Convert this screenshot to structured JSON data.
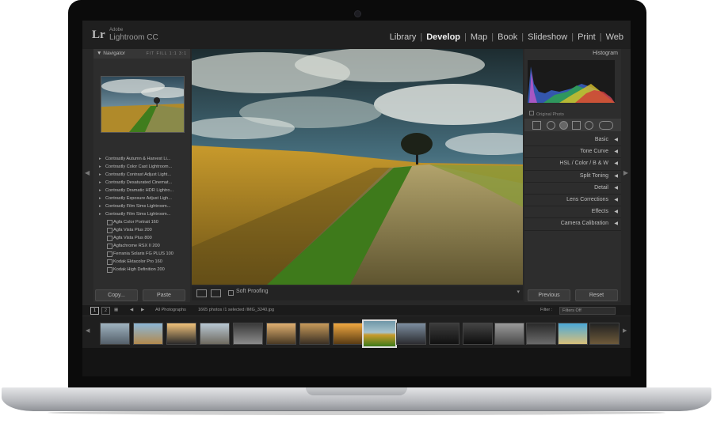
{
  "app": {
    "logo_mark": "Lr",
    "logo_small": "Adobe",
    "name": "Lightroom CC"
  },
  "modules": [
    "Library",
    "Develop",
    "Map",
    "Book",
    "Slideshow",
    "Print",
    "Web"
  ],
  "active_module": "Develop",
  "navigator": {
    "title": "Navigator",
    "options": "FIT  FILL  1:1  3:1"
  },
  "presets": [
    {
      "label": "Contrastly Autumn & Harvest Li...",
      "kind": "folder"
    },
    {
      "label": "Contrastly Color Cast Lightroom...",
      "kind": "folder"
    },
    {
      "label": "Contrastly Contrast Adjust Light...",
      "kind": "folder"
    },
    {
      "label": "Contrastly Desaturated Cinemat...",
      "kind": "folder"
    },
    {
      "label": "Contrastly Dramatic HDR Lightro...",
      "kind": "folder"
    },
    {
      "label": "Contrastly Exposure Adjust Ligh...",
      "kind": "folder"
    },
    {
      "label": "Contrastly Film Sims Lightroom...",
      "kind": "folder"
    },
    {
      "label": "Contrastly Film Sims Lightroom...",
      "kind": "folder"
    },
    {
      "label": "Agfa Color Portrait 160",
      "kind": "item"
    },
    {
      "label": "Agfa Vista Plus 200",
      "kind": "item"
    },
    {
      "label": "Agfa Vista Plus 800",
      "kind": "item"
    },
    {
      "label": "Agfachrome RSX II 200",
      "kind": "item"
    },
    {
      "label": "Ferrania Solaris FG PLUS 100",
      "kind": "item"
    },
    {
      "label": "Kodak Ektacolor Pro 160",
      "kind": "item"
    },
    {
      "label": "Kodak High Definition 200",
      "kind": "item"
    }
  ],
  "left_buttons": {
    "copy": "Copy...",
    "paste": "Paste"
  },
  "toolbar": {
    "soft_proofing": "Soft Proofing"
  },
  "histogram": {
    "title": "Histogram",
    "original_photo": "Original Photo"
  },
  "sections": [
    "Basic",
    "Tone Curve",
    "HSL / Color / B & W",
    "Split Toning",
    "Detail",
    "Lens Corrections",
    "Effects",
    "Camera Calibration"
  ],
  "right_buttons": {
    "previous": "Previous",
    "reset": "Reset"
  },
  "filmstrip": {
    "page_1": "1",
    "page_2": "2",
    "source": "All Photographs",
    "status": "1665 photos /1 selected /IMG_3240.jpg",
    "filter_label": "Filter :",
    "filter_value": "Filters Off"
  }
}
